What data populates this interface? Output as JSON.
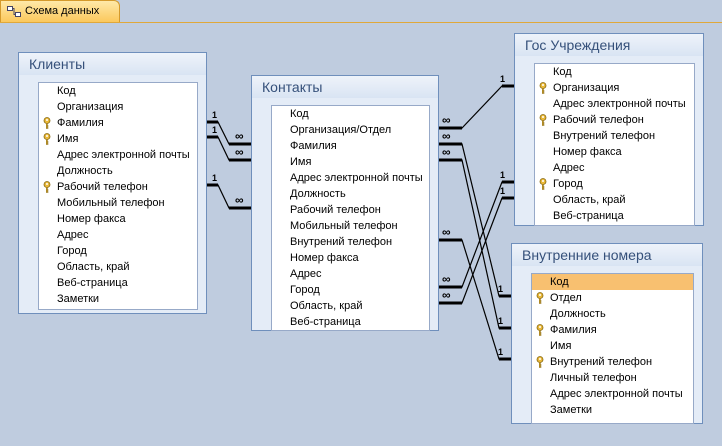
{
  "tab": {
    "label": "Схема данных",
    "icon": "relationships-icon"
  },
  "tables": {
    "clients": {
      "title": "Клиенты",
      "fields": [
        {
          "name": "Код",
          "key": false
        },
        {
          "name": "Организация",
          "key": false
        },
        {
          "name": "Фамилия",
          "key": true
        },
        {
          "name": "Имя",
          "key": true
        },
        {
          "name": "Адрес электронной почты",
          "key": false
        },
        {
          "name": "Должность",
          "key": false
        },
        {
          "name": "Рабочий телефон",
          "key": true
        },
        {
          "name": "Мобильный телефон",
          "key": false
        },
        {
          "name": "Номер факса",
          "key": false
        },
        {
          "name": "Адрес",
          "key": false
        },
        {
          "name": "Город",
          "key": false
        },
        {
          "name": "Область, край",
          "key": false
        },
        {
          "name": "Веб-страница",
          "key": false
        },
        {
          "name": "Заметки",
          "key": false
        }
      ]
    },
    "contacts": {
      "title": "Контакты",
      "fields": [
        {
          "name": "Код",
          "key": false
        },
        {
          "name": "Организация/Отдел",
          "key": false
        },
        {
          "name": "Фамилия",
          "key": false
        },
        {
          "name": "Имя",
          "key": false
        },
        {
          "name": "Адрес электронной почты",
          "key": false
        },
        {
          "name": "Должность",
          "key": false
        },
        {
          "name": "Рабочий телефон",
          "key": false
        },
        {
          "name": "Мобильный телефон",
          "key": false
        },
        {
          "name": "Внутрений телефон",
          "key": false
        },
        {
          "name": "Номер факса",
          "key": false
        },
        {
          "name": "Адрес",
          "key": false
        },
        {
          "name": "Город",
          "key": false
        },
        {
          "name": "Область, край",
          "key": false
        },
        {
          "name": "Веб-страница",
          "key": false
        }
      ]
    },
    "gov": {
      "title": "Гос Учреждения",
      "fields": [
        {
          "name": "Код",
          "key": false
        },
        {
          "name": "Организация",
          "key": true
        },
        {
          "name": "Адрес электронной почты",
          "key": false
        },
        {
          "name": "Рабочий телефон",
          "key": true
        },
        {
          "name": "Внутрений телефон",
          "key": false
        },
        {
          "name": "Номер факса",
          "key": false
        },
        {
          "name": "Адрес",
          "key": false
        },
        {
          "name": "Город",
          "key": true
        },
        {
          "name": "Область, край",
          "key": false
        },
        {
          "name": "Веб-страница",
          "key": false
        }
      ]
    },
    "internal": {
      "title": "Внутренние номера",
      "fields": [
        {
          "name": "Код",
          "key": false,
          "selected": true
        },
        {
          "name": "Отдел",
          "key": true
        },
        {
          "name": "Должность",
          "key": false
        },
        {
          "name": "Фамилия",
          "key": true
        },
        {
          "name": "Имя",
          "key": false
        },
        {
          "name": "Внутрений телефон",
          "key": true
        },
        {
          "name": "Личный телефон",
          "key": false
        },
        {
          "name": "Адрес электронной почты",
          "key": false
        },
        {
          "name": "Заметки",
          "key": false
        }
      ]
    }
  },
  "relationships": {
    "one_label": "1",
    "many_label": "∞"
  },
  "colors": {
    "key": "#c99a1e",
    "selected_row": "#f8c070",
    "title_text": "#35507a"
  }
}
